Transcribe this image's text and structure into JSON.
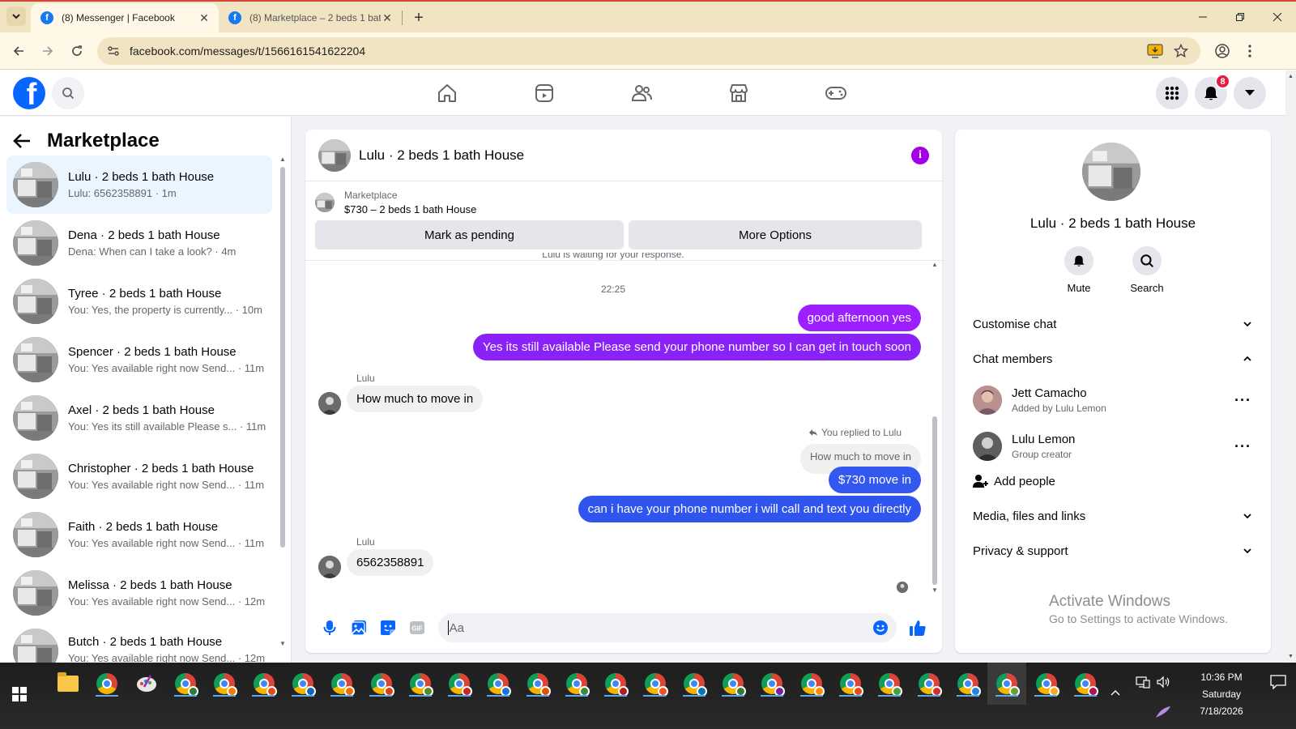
{
  "browser": {
    "tabs": [
      {
        "title": "(8) Messenger | Facebook",
        "active": true
      },
      {
        "title": "(8) Marketplace – 2 beds 1 bath",
        "active": false
      }
    ],
    "url": "facebook.com/messages/t/1566161541622204"
  },
  "fb_header": {
    "notification_count": "8"
  },
  "sidebar": {
    "title": "Marketplace",
    "conversations": [
      {
        "name": "Lulu · 2 beds 1 bath House",
        "preview": "Lulu: 6562358891 · 1m",
        "active": true
      },
      {
        "name": "Dena · 2 beds 1 bath House",
        "preview": "Dena: When can I take a look? · 4m",
        "active": false
      },
      {
        "name": "Tyree · 2 beds 1 bath House",
        "preview": "You: Yes, the property is currently... · 10m",
        "active": false
      },
      {
        "name": "Spencer · 2 beds 1 bath House",
        "preview": "You: Yes available right now Send... · 11m",
        "active": false
      },
      {
        "name": "Axel · 2 beds 1 bath House",
        "preview": "You: Yes its still available Please s... · 11m",
        "active": false
      },
      {
        "name": "Christopher · 2 beds 1 bath House",
        "preview": "You: Yes available right now Send... · 11m",
        "active": false
      },
      {
        "name": "Faith · 2 beds 1 bath House",
        "preview": "You: Yes available right now Send... · 11m",
        "active": false
      },
      {
        "name": "Melissa · 2 beds 1 bath House",
        "preview": "You: Yes available right now Send... · 12m",
        "active": false
      },
      {
        "name": "Butch · 2 beds 1 bath House",
        "preview": "You: Yes available right now Send... · 12m",
        "active": false
      }
    ]
  },
  "chat": {
    "title": "Lulu · 2 beds 1 bath House",
    "marketplace_label": "Marketplace",
    "listing": "$730 – 2 beds 1 bath House",
    "mark_pending": "Mark as pending",
    "more_options": "More Options",
    "cut_notice": "Lulu is waiting for your response.",
    "timestamp": "22:25",
    "messages": {
      "m1": "good afternoon yes",
      "m2": "Yes its still available Please send your phone number so I can get in touch soon",
      "sender1": "Lulu",
      "m3": "How much to move in",
      "reply_note": "You replied to Lulu",
      "quoted": "How much to move in",
      "m4": "$730  move in",
      "m5": "can i have your phone number i will call and text you directly",
      "sender2": "Lulu",
      "m6": "6562358891"
    },
    "input_placeholder": "Aa",
    "colors": {
      "accent": "#a200ff",
      "bubble_blue": "#2f5ef4",
      "bubble_purple": "#8b2cf5"
    }
  },
  "info_panel": {
    "name": "Lulu · 2 beds 1 bath House",
    "mute": "Mute",
    "search": "Search",
    "customise_chat": "Customise chat",
    "chat_members": "Chat members",
    "members": [
      {
        "name": "Jett Camacho",
        "sub": "Added by Lulu Lemon"
      },
      {
        "name": "Lulu Lemon",
        "sub": "Group creator"
      }
    ],
    "add_people": "Add people",
    "media": "Media, files and links",
    "privacy": "Privacy & support",
    "activate_title": "Activate Windows",
    "activate_sub": "Go to Settings to activate Windows."
  },
  "taskbar": {
    "time": "10:36 PM",
    "day": "Saturday",
    "date": "7/18/2026"
  }
}
